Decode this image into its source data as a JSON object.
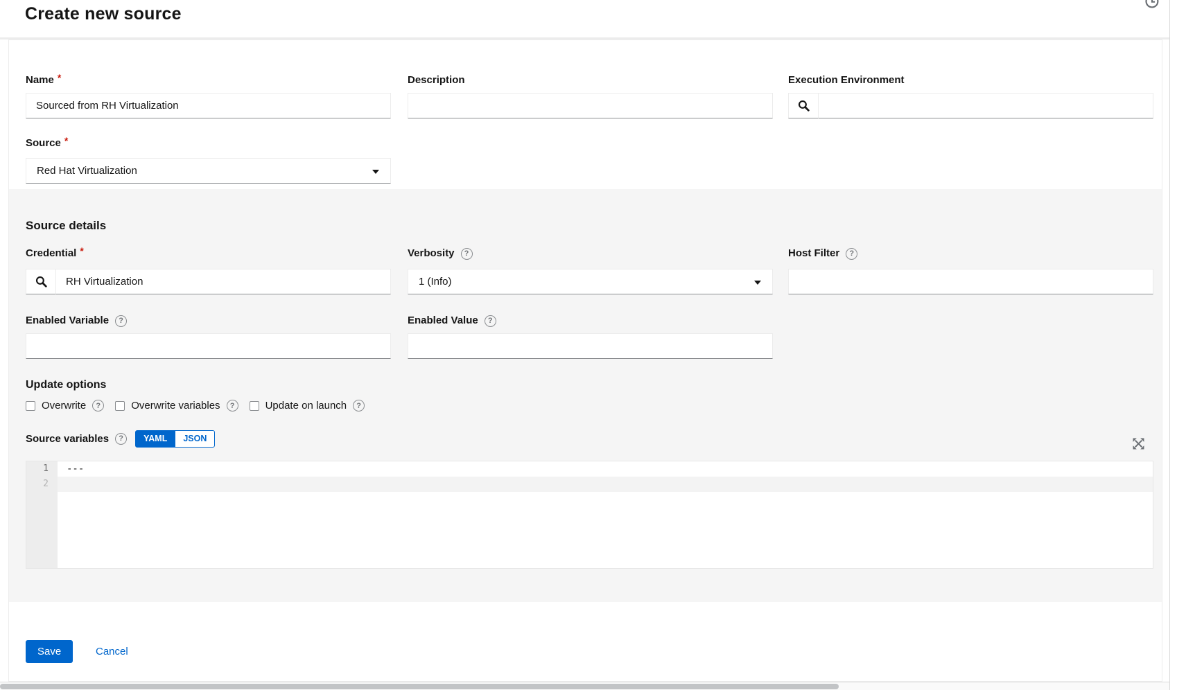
{
  "page": {
    "title": "Create new source"
  },
  "icons": {
    "help_glyph": "?"
  },
  "form": {
    "name": {
      "label": "Name",
      "required": "*",
      "value": "Sourced from RH Virtualization"
    },
    "description": {
      "label": "Description",
      "value": ""
    },
    "execution_environment": {
      "label": "Execution Environment",
      "value": ""
    },
    "source": {
      "label": "Source",
      "required": "*",
      "value": "Red Hat Virtualization"
    }
  },
  "source_details": {
    "heading": "Source details",
    "credential": {
      "label": "Credential",
      "required": "*",
      "value": "RH Virtualization"
    },
    "verbosity": {
      "label": "Verbosity",
      "value": "1 (Info)"
    },
    "host_filter": {
      "label": "Host Filter",
      "value": ""
    },
    "enabled_variable": {
      "label": "Enabled Variable",
      "value": ""
    },
    "enabled_value": {
      "label": "Enabled Value",
      "value": ""
    },
    "update_options": {
      "heading": "Update options",
      "checkboxes": [
        {
          "label": "Overwrite",
          "checked": false
        },
        {
          "label": "Overwrite variables",
          "checked": false
        },
        {
          "label": "Update on launch",
          "checked": false
        }
      ]
    },
    "source_variables": {
      "label": "Source variables",
      "toggle": [
        {
          "label": "YAML",
          "active": true
        },
        {
          "label": "JSON",
          "active": false
        }
      ],
      "editor": {
        "lines": [
          {
            "number": "1",
            "content": "---"
          },
          {
            "number": "2",
            "content": ""
          }
        ]
      }
    }
  },
  "footer": {
    "save": "Save",
    "cancel": "Cancel"
  },
  "colors": {
    "accent": "#0066cc",
    "required": "#c9190b",
    "section_bg": "#f5f5f5"
  }
}
